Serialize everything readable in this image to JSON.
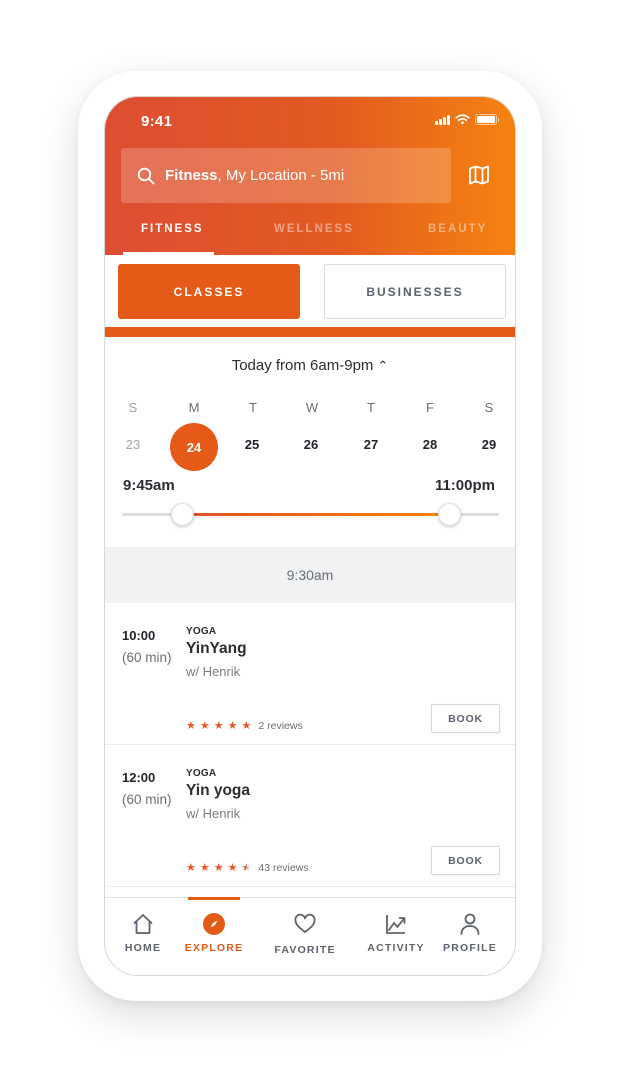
{
  "status_bar": {
    "time": "9:41"
  },
  "search": {
    "category": "Fitness",
    "rest": ", My Location - 5mi",
    "icon": "search-icon"
  },
  "map_button": {
    "icon": "map-icon"
  },
  "category_tabs": [
    {
      "label": "FITNESS",
      "active": true
    },
    {
      "label": "WELLNESS",
      "active": false
    },
    {
      "label": "BEAUTY",
      "active": false
    }
  ],
  "segmented": {
    "classes": "CLASSES",
    "businesses": "BUSINESSES",
    "selected": "CLASSES"
  },
  "date_picker": {
    "title": "Today from 6am-9pm",
    "chevron": "^",
    "day_letters": [
      "S",
      "M",
      "T",
      "W",
      "T",
      "F",
      "S"
    ],
    "day_numbers": [
      "23",
      "24",
      "25",
      "26",
      "27",
      "28",
      "29"
    ],
    "selected_day": "24",
    "past_day": "23"
  },
  "time_range": {
    "start_label": "9:45am",
    "end_label": "11:00pm",
    "start_fraction": 0.16,
    "end_fraction": 0.87
  },
  "time_separator": "9:30am",
  "classes": [
    {
      "start": "10:00",
      "duration": "(60 min)",
      "category": "YOGA",
      "name": "YinYang",
      "instructor": "w/ Henrik",
      "rating": 5,
      "reviews": "2 reviews",
      "book_label": "BOOK"
    },
    {
      "start": "12:00",
      "duration": "(60 min)",
      "category": "YOGA",
      "name": "Yin yoga",
      "instructor": "w/ Henrik",
      "rating": 4.5,
      "reviews": "43 reviews",
      "book_label": "BOOK"
    }
  ],
  "bottom_nav": [
    {
      "label": "HOME",
      "icon": "home-icon",
      "active": false
    },
    {
      "label": "EXPLORE",
      "icon": "compass-icon",
      "active": true
    },
    {
      "label": "FAVORITE",
      "icon": "heart-icon",
      "active": false
    },
    {
      "label": "ACTIVITY",
      "icon": "chart-line-icon",
      "active": false
    },
    {
      "label": "PROFILE",
      "icon": "user-icon",
      "active": false
    }
  ],
  "colors": {
    "accent": "#e55a17",
    "gradient_start": "#dd4d32",
    "gradient_end": "#f5820f",
    "star": "#e9582a"
  }
}
